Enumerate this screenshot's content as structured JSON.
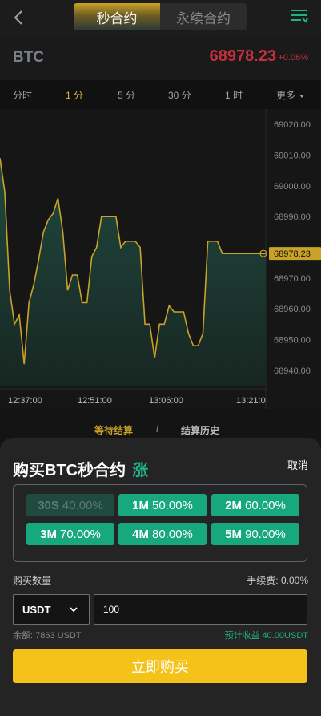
{
  "header": {
    "tabs": [
      {
        "label": "秒合约",
        "active": true
      },
      {
        "label": "永续合约",
        "active": false
      }
    ]
  },
  "ticker": {
    "symbol": "BTC",
    "price": "68978.23",
    "change": "+0.06%"
  },
  "intervals": [
    {
      "label": "分时",
      "active": false
    },
    {
      "label": "1 分",
      "active": true
    },
    {
      "label": "5 分",
      "active": false
    },
    {
      "label": "30 分",
      "active": false
    },
    {
      "label": "1 时",
      "active": false
    },
    {
      "label": "更多",
      "active": false
    }
  ],
  "chart_data": {
    "type": "area",
    "y_ticks": [
      "69020.00",
      "69010.00",
      "69000.00",
      "68990.00",
      "68970.00",
      "68960.00",
      "68950.00",
      "68940.00"
    ],
    "x_ticks": [
      "12:37:00",
      "12:51:00",
      "13:06:00",
      "13:21:0"
    ],
    "current_price_label": "68978.23",
    "ylim": [
      68935,
      69025
    ],
    "values": [
      69009,
      68998,
      68966,
      68955,
      68958,
      68942,
      68962,
      68968,
      68976,
      68985,
      68989,
      68991,
      68996,
      68985,
      68966,
      68971,
      68971,
      68962,
      68962,
      68977,
      68980,
      68990,
      68990,
      68990,
      68990,
      68980,
      68982,
      68982,
      68982,
      68980,
      68955,
      68955,
      68944,
      68955,
      68955,
      68961,
      68959,
      68959,
      68959,
      68952,
      68948,
      68948,
      68952,
      68982,
      68982,
      68982,
      68978,
      68978,
      68978,
      68978,
      68978,
      68978,
      68978,
      68978,
      68978,
      68978
    ],
    "line_color": "#c9a227",
    "fill_color": "#1f4a3e"
  },
  "result_tabs": {
    "pending": "等待结算",
    "separator": "/",
    "history": "结算历史"
  },
  "order": {
    "title": "购买BTC秒合约",
    "direction": "涨",
    "cancel": "取消",
    "durations": [
      {
        "time": "30S",
        "rate": "40.00%",
        "enabled": false
      },
      {
        "time": "1M",
        "rate": "50.00%",
        "enabled": true
      },
      {
        "time": "2M",
        "rate": "60.00%",
        "enabled": true
      },
      {
        "time": "3M",
        "rate": "70.00%",
        "enabled": true
      },
      {
        "time": "4M",
        "rate": "80.00%",
        "enabled": true
      },
      {
        "time": "5M",
        "rate": "90.00%",
        "enabled": true
      }
    ],
    "qty_label": "购买数量",
    "fee": "手续费: 0.00%",
    "currency": "USDT",
    "amount": "100",
    "balance": "余额: 7863 USDT",
    "estimate": "预计收益 40.00USDT",
    "buy_label": "立即购买"
  },
  "colors": {
    "up": "#1eb386",
    "down": "#c4303c",
    "gold": "#c9a227",
    "buy": "#f5c219"
  }
}
